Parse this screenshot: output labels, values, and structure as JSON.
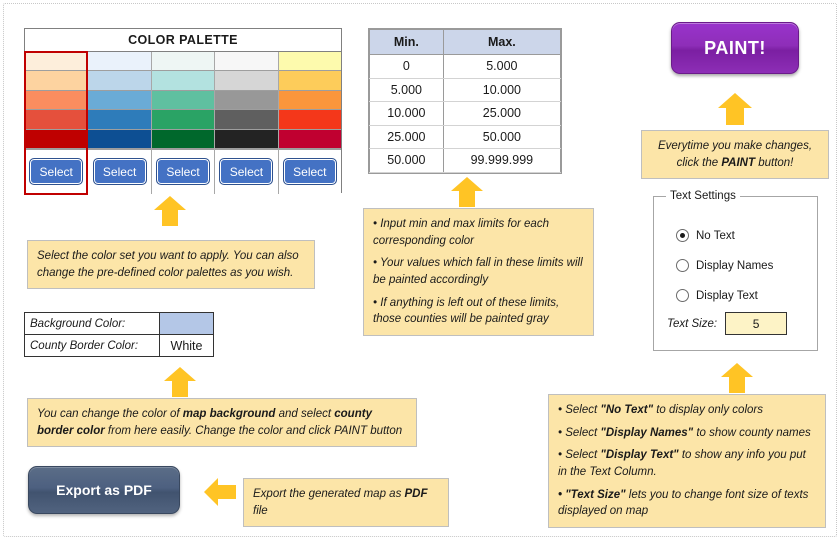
{
  "palette": {
    "title": "COLOR PALETTE",
    "select_label": "Select",
    "columns": [
      {
        "name": "orange-red-set",
        "selected": true,
        "swatches": [
          "#fdeedb",
          "#fdd3a0",
          "#fb8d5f",
          "#e5503c",
          "#bf0000"
        ]
      },
      {
        "name": "blue-set",
        "selected": false,
        "swatches": [
          "#eaf2fb",
          "#bcd6ea",
          "#6aabd6",
          "#2e7cba",
          "#0d4f93"
        ]
      },
      {
        "name": "green-teal-set",
        "selected": false,
        "swatches": [
          "#eef6f4",
          "#b3e2e0",
          "#5fc0a0",
          "#2aa365",
          "#00682c"
        ]
      },
      {
        "name": "grayscale-set",
        "selected": false,
        "swatches": [
          "#f7f7f7",
          "#d6d6d6",
          "#989898",
          "#5f5f5f",
          "#232323"
        ]
      },
      {
        "name": "yellow-crimson-set",
        "selected": false,
        "swatches": [
          "#fdfaad",
          "#fdcc5a",
          "#fb963c",
          "#f4371a",
          "#c00030"
        ]
      }
    ]
  },
  "limits_table": {
    "headers": [
      "Min.",
      "Max."
    ],
    "rows": [
      [
        "0",
        "5.000"
      ],
      [
        "5.000",
        "10.000"
      ],
      [
        "10.000",
        "25.000"
      ],
      [
        "25.000",
        "50.000"
      ],
      [
        "50.000",
        "99.999.999"
      ]
    ]
  },
  "paint": {
    "label": "PAINT!",
    "note_line1": "Everytime you make changes,",
    "note_line2_pre": "click the ",
    "note_line2_bold": "PAINT",
    "note_line2_post": " button!"
  },
  "palette_note": {
    "text": "Select the color set you want to apply. You can also change the pre-defined color palettes as you wish."
  },
  "limits_note": {
    "bullet1": "• Input min and max limits for each corresponding color",
    "bullet2": "• Your values which fall in these limits will be painted accordingly",
    "bullet3": "• If anything is left out of these limits, those counties will be painted gray"
  },
  "background_table": {
    "row1_label": "Background Color:",
    "row1_value": "",
    "row1_swatch_color": "#b4c7e7",
    "row2_label": "County Border Color:",
    "row2_value": "White"
  },
  "background_note": {
    "pre": "You can change the color of ",
    "bold1": "map background",
    "mid": " and select ",
    "bold2": "county border color",
    "post": " from here easily. Change the color and click PAINT button"
  },
  "export": {
    "label": "Export as PDF",
    "note_pre": "Export the generated map as ",
    "note_bold": "PDF",
    "note_post": " file"
  },
  "text_settings": {
    "legend": "Text Settings",
    "options": [
      {
        "label": "No Text",
        "checked": true
      },
      {
        "label": "Display Names",
        "checked": false
      },
      {
        "label": "Display Text",
        "checked": false
      }
    ],
    "text_size_label": "Text Size:",
    "text_size_value": "5"
  },
  "text_settings_note": {
    "b1_pre": "• Select ",
    "b1_bold": "\"No Text\"",
    "b1_post": " to display only colors",
    "b2_pre": "• Select ",
    "b2_bold": "\"Display Names\"",
    "b2_post": " to show county names",
    "b3_pre": "• Select ",
    "b3_bold": "\"Display Text\"",
    "b3_post": " to show any info you put in the Text Column.",
    "b4_bold": "• \"Text Size\"",
    "b4_post": " lets you to change font size of texts displayed on map"
  },
  "colors": {
    "arrow": "#ffc425",
    "note_bg": "#fce5a8",
    "paint_button": "#8e2eb8",
    "export_button": "#4d6080",
    "select_button": "#4472c4",
    "table_header": "#ccd6ea",
    "selection_outline": "#c00000"
  }
}
